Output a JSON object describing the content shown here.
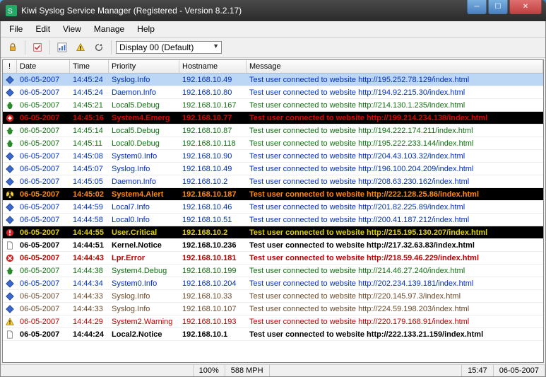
{
  "window": {
    "title": "Kiwi Syslog Service Manager (Registered - Version 8.2.17)"
  },
  "menu": {
    "file": "File",
    "edit": "Edit",
    "view": "View",
    "manage": "Manage",
    "help": "Help"
  },
  "toolbar": {
    "display_label": "Display 00 (Default)"
  },
  "columns": {
    "icon": "!",
    "date": "Date",
    "time": "Time",
    "priority": "Priority",
    "hostname": "Hostname",
    "message": "Message"
  },
  "rows": [
    {
      "style": "sel blue",
      "icon": "diamond-blue",
      "date": "06-05-2007",
      "time": "14:45:24",
      "priority": "Syslog.Info",
      "host": "192.168.10.49",
      "msg": "Test user connected to website http://195.252.78.129/index.html"
    },
    {
      "style": "blue",
      "icon": "diamond-blue",
      "date": "06-05-2007",
      "time": "14:45:24",
      "priority": "Daemon.Info",
      "host": "192.168.10.80",
      "msg": "Test user connected to website http://194.92.215.30/index.html"
    },
    {
      "style": "green",
      "icon": "bug-green",
      "date": "06-05-2007",
      "time": "14:45:21",
      "priority": "Local5.Debug",
      "host": "192.168.10.167",
      "msg": "Test user connected to website http://214.130.1.235/index.html"
    },
    {
      "style": "emerg",
      "icon": "cross-red",
      "date": "06-05-2007",
      "time": "14:45:16",
      "priority": "System4.Emerg",
      "host": "192.168.10.77",
      "msg": "Test user connected to website http://199.214.234.138/index.html"
    },
    {
      "style": "green",
      "icon": "bug-green",
      "date": "06-05-2007",
      "time": "14:45:14",
      "priority": "Local5.Debug",
      "host": "192.168.10.87",
      "msg": "Test user connected to website http://194.222.174.211/index.html"
    },
    {
      "style": "green",
      "icon": "bug-green",
      "date": "06-05-2007",
      "time": "14:45:11",
      "priority": "Local0.Debug",
      "host": "192.168.10.118",
      "msg": "Test user connected to website http://195.222.233.144/index.html"
    },
    {
      "style": "blue",
      "icon": "diamond-blue",
      "date": "06-05-2007",
      "time": "14:45:08",
      "priority": "System0.Info",
      "host": "192.168.10.90",
      "msg": "Test user connected to website http://204.43.103.32/index.html"
    },
    {
      "style": "blue",
      "icon": "diamond-blue",
      "date": "06-05-2007",
      "time": "14:45:07",
      "priority": "Syslog.Info",
      "host": "192.168.10.49",
      "msg": "Test user connected to website http://196.100.204.209/index.html"
    },
    {
      "style": "blue",
      "icon": "diamond-blue",
      "date": "06-05-2007",
      "time": "14:45:05",
      "priority": "Daemon.Info",
      "host": "192.168.10.2",
      "msg": "Test user connected to website http://208.63.230.162/index.html"
    },
    {
      "style": "alert",
      "icon": "radiation",
      "date": "06-05-2007",
      "time": "14:45:02",
      "priority": "System4.Alert",
      "host": "192.168.10.187",
      "msg": "Test user connected to website http://222.128.25.86/index.html"
    },
    {
      "style": "blue",
      "icon": "diamond-blue",
      "date": "06-05-2007",
      "time": "14:44:59",
      "priority": "Local7.Info",
      "host": "192.168.10.46",
      "msg": "Test user connected to website http://201.82.225.89/index.html"
    },
    {
      "style": "blue",
      "icon": "diamond-blue",
      "date": "06-05-2007",
      "time": "14:44:58",
      "priority": "Local0.Info",
      "host": "192.168.10.51",
      "msg": "Test user connected to website http://200.41.187.212/index.html"
    },
    {
      "style": "crit",
      "icon": "excl-red",
      "date": "06-05-2007",
      "time": "14:44:55",
      "priority": "User.Critical",
      "host": "192.168.10.2",
      "msg": "Test user connected to website http://215.195.130.207/index.html"
    },
    {
      "style": "bold",
      "icon": "page",
      "date": "06-05-2007",
      "time": "14:44:51",
      "priority": "Kernel.Notice",
      "host": "192.168.10.236",
      "msg": "Test user connected to website http://217.32.63.83/index.html"
    },
    {
      "style": "error",
      "icon": "x-red",
      "date": "06-05-2007",
      "time": "14:44:43",
      "priority": "Lpr.Error",
      "host": "192.168.10.181",
      "msg": "Test user connected to website http://218.59.46.229/index.html"
    },
    {
      "style": "green",
      "icon": "bug-green",
      "date": "06-05-2007",
      "time": "14:44:38",
      "priority": "System4.Debug",
      "host": "192.168.10.199",
      "msg": "Test user connected to website http://214.46.27.240/index.html"
    },
    {
      "style": "blue",
      "icon": "diamond-blue",
      "date": "06-05-2007",
      "time": "14:44:34",
      "priority": "System0.Info",
      "host": "192.168.10.204",
      "msg": "Test user connected to website http://202.234.139.181/index.html"
    },
    {
      "style": "brown",
      "icon": "diamond-blue",
      "date": "06-05-2007",
      "time": "14:44:33",
      "priority": "Syslog.Info",
      "host": "192.168.10.33",
      "msg": "Test user connected to website http://220.145.97.3/index.html"
    },
    {
      "style": "brown",
      "icon": "diamond-blue",
      "date": "06-05-2007",
      "time": "14:44:33",
      "priority": "Syslog.Info",
      "host": "192.168.10.107",
      "msg": "Test user connected to website http://224.59.198.203/index.html"
    },
    {
      "style": "red",
      "icon": "warn-yellow",
      "date": "06-05-2007",
      "time": "14:44:29",
      "priority": "System2.Warning",
      "host": "192.168.10.193",
      "msg": "Test user connected to website http://220.179.168.91/index.html"
    },
    {
      "style": "bold",
      "icon": "page",
      "date": "06-05-2007",
      "time": "14:44:24",
      "priority": "Local2.Notice",
      "host": "192.168.10.1",
      "msg": "Test user connected to website http://222.133.21.159/index.html"
    }
  ],
  "status": {
    "zoom": "100%",
    "rate": "588 MPH",
    "time": "15:47",
    "date": "06-05-2007"
  }
}
